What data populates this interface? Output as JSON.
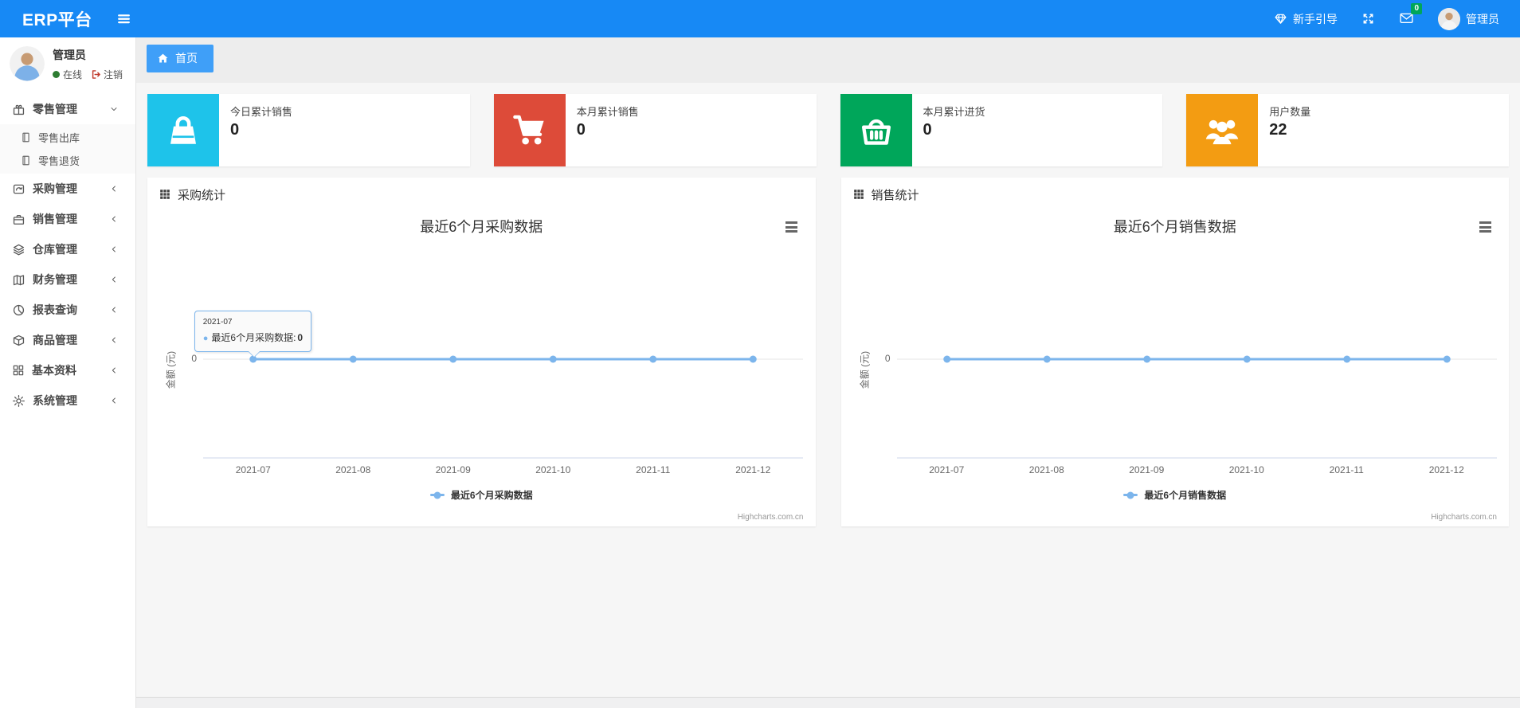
{
  "navbar": {
    "brand": "ERP平台",
    "guide_label": "新手引导",
    "guide_icon": "gem-icon",
    "fullscreen_icon": "expand-icon",
    "mail_icon": "envelope-icon",
    "mail_badge_count": "0",
    "username": "管理员"
  },
  "sidebar": {
    "user": {
      "name": "管理员",
      "status": "在线",
      "logout": "注销"
    },
    "menu": [
      {
        "label": "零售管理",
        "icon": "gift-icon",
        "state": "expanded",
        "children": [
          {
            "label": "零售出库",
            "icon": "file-icon"
          },
          {
            "label": "零售退货",
            "icon": "file-icon"
          }
        ]
      },
      {
        "label": "采购管理",
        "icon": "sync-icon",
        "state": "collapsed"
      },
      {
        "label": "销售管理",
        "icon": "briefcase-icon",
        "state": "collapsed"
      },
      {
        "label": "仓库管理",
        "icon": "layers-icon",
        "state": "collapsed"
      },
      {
        "label": "财务管理",
        "icon": "map-icon",
        "state": "collapsed"
      },
      {
        "label": "报表查询",
        "icon": "pie-icon",
        "state": "collapsed"
      },
      {
        "label": "商品管理",
        "icon": "box-icon",
        "state": "collapsed"
      },
      {
        "label": "基本资料",
        "icon": "grid4-icon",
        "state": "collapsed"
      },
      {
        "label": "系统管理",
        "icon": "gear-icon",
        "state": "collapsed"
      }
    ]
  },
  "tabs": [
    {
      "label": "首页",
      "icon": "home-icon",
      "active": true
    }
  ],
  "stat_cards": [
    {
      "label": "今日累计销售",
      "value": "0",
      "icon": "bag-icon",
      "color": "#1ec3ea"
    },
    {
      "label": "本月累计销售",
      "value": "0",
      "icon": "cart-icon",
      "color": "#dd4b39"
    },
    {
      "label": "本月累计进货",
      "value": "0",
      "icon": "basket-icon",
      "color": "#00a65a"
    },
    {
      "label": "用户数量",
      "value": "22",
      "icon": "users-icon",
      "color": "#f39c12"
    }
  ],
  "panels": [
    {
      "header": "采购统计",
      "header_icon": "th-grid-icon"
    },
    {
      "header": "销售统计",
      "header_icon": "th-grid-icon"
    }
  ],
  "chart_data": [
    {
      "type": "line",
      "title": "最近6个月采购数据",
      "categories": [
        "2021-07",
        "2021-08",
        "2021-09",
        "2021-10",
        "2021-11",
        "2021-12"
      ],
      "series": [
        {
          "name": "最近6个月采购数据",
          "values": [
            0,
            0,
            0,
            0,
            0,
            0
          ]
        }
      ],
      "xlabel": "",
      "ylabel": "金额 (元)",
      "y_ticks": [
        "0"
      ],
      "ylim": [
        0,
        0
      ],
      "grid": false,
      "legend_position": "bottom",
      "line_color": "#7cb5ec",
      "credits": "Highcharts.com.cn",
      "tooltip": {
        "header": "2021-07",
        "series": "最近6个月采购数据",
        "separator": ":",
        "value": "0"
      }
    },
    {
      "type": "line",
      "title": "最近6个月销售数据",
      "categories": [
        "2021-07",
        "2021-08",
        "2021-09",
        "2021-10",
        "2021-11",
        "2021-12"
      ],
      "series": [
        {
          "name": "最近6个月销售数据",
          "values": [
            0,
            0,
            0,
            0,
            0,
            0
          ]
        }
      ],
      "xlabel": "",
      "ylabel": "金额 (元)",
      "y_ticks": [
        "0"
      ],
      "ylim": [
        0,
        0
      ],
      "grid": false,
      "legend_position": "bottom",
      "line_color": "#7cb5ec",
      "credits": "Highcharts.com.cn"
    }
  ]
}
